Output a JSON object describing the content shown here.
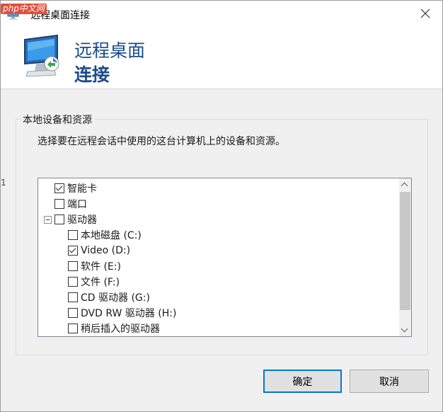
{
  "window": {
    "title": "远程桌面连接",
    "badge": "php中文网"
  },
  "header": {
    "line1": "远程桌面",
    "line2": "连接"
  },
  "edge_marks": [
    "1"
  ],
  "group": {
    "title": "本地设备和资源",
    "description": "选择要在远程会话中使用的这台计算机上的设备和资源。"
  },
  "tree": {
    "items": [
      {
        "label": "智能卡",
        "checked": true,
        "level": 0
      },
      {
        "label": "端口",
        "checked": false,
        "level": 0
      },
      {
        "label": "驱动器",
        "checked": false,
        "level": 0,
        "expanded": true
      },
      {
        "label": "本地磁盘 (C:)",
        "checked": false,
        "level": 1
      },
      {
        "label": "Video (D:)",
        "checked": true,
        "level": 1
      },
      {
        "label": "软件 (E:)",
        "checked": false,
        "level": 1
      },
      {
        "label": "文件 (F:)",
        "checked": false,
        "level": 1
      },
      {
        "label": "CD 驱动器 (G:)",
        "checked": false,
        "level": 1
      },
      {
        "label": "DVD RW 驱动器 (H:)",
        "checked": false,
        "level": 1
      },
      {
        "label": "稍后插入的驱动器",
        "checked": false,
        "level": 1
      }
    ]
  },
  "buttons": {
    "ok": "确定",
    "cancel": "取消"
  },
  "colors": {
    "header_text": "#1b4c8a",
    "accent": "#0078d7"
  }
}
